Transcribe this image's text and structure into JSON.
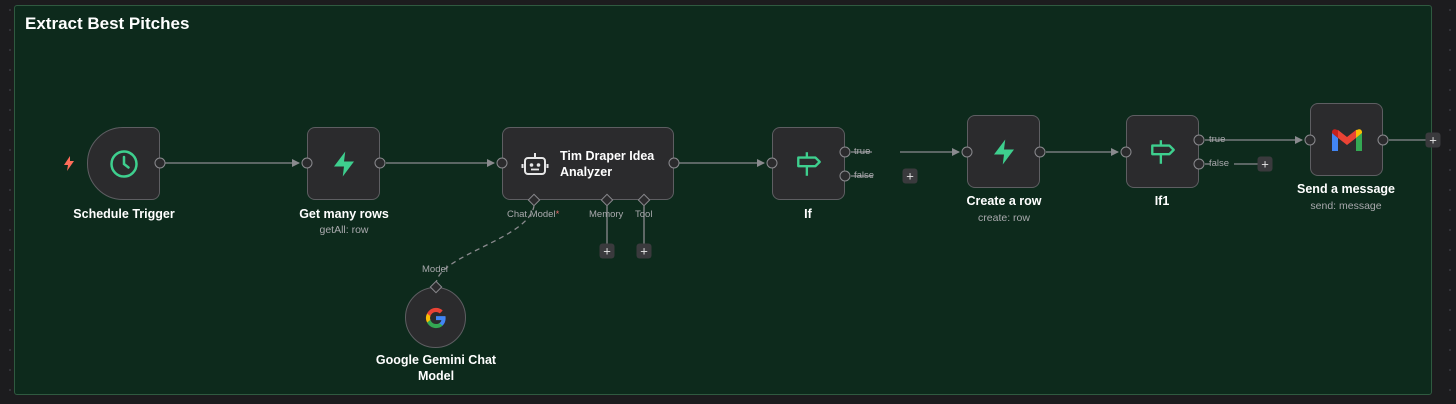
{
  "canvas": {
    "sticky_title": "Extract Best Pitches"
  },
  "nodes": {
    "schedule_trigger": {
      "label": "Schedule Trigger"
    },
    "get_many_rows": {
      "label": "Get many rows",
      "sublabel": "getAll: row"
    },
    "agent": {
      "label": "Tim Draper Idea Analyzer"
    },
    "if": {
      "label": "If",
      "true_label": "true",
      "false_label": "false"
    },
    "create_row": {
      "label": "Create a row",
      "sublabel": "create: row"
    },
    "if1": {
      "label": "If1",
      "true_label": "true",
      "false_label": "false"
    },
    "send_message": {
      "label": "Send a message",
      "sublabel": "send: message"
    },
    "gemini": {
      "label_line1": "Google Gemini Chat",
      "label_line2": "Model",
      "input_label": "Model"
    }
  },
  "agent_ports": {
    "chat_model": "Chat Model",
    "chat_model_required": "*",
    "memory": "Memory",
    "tool": "Tool"
  },
  "buttons": {
    "plus": "+"
  },
  "colors": {
    "accent_green": "#3ecf8e",
    "trigger_red": "#ff6d5a",
    "sticky_bg": "#0d2a1c"
  }
}
